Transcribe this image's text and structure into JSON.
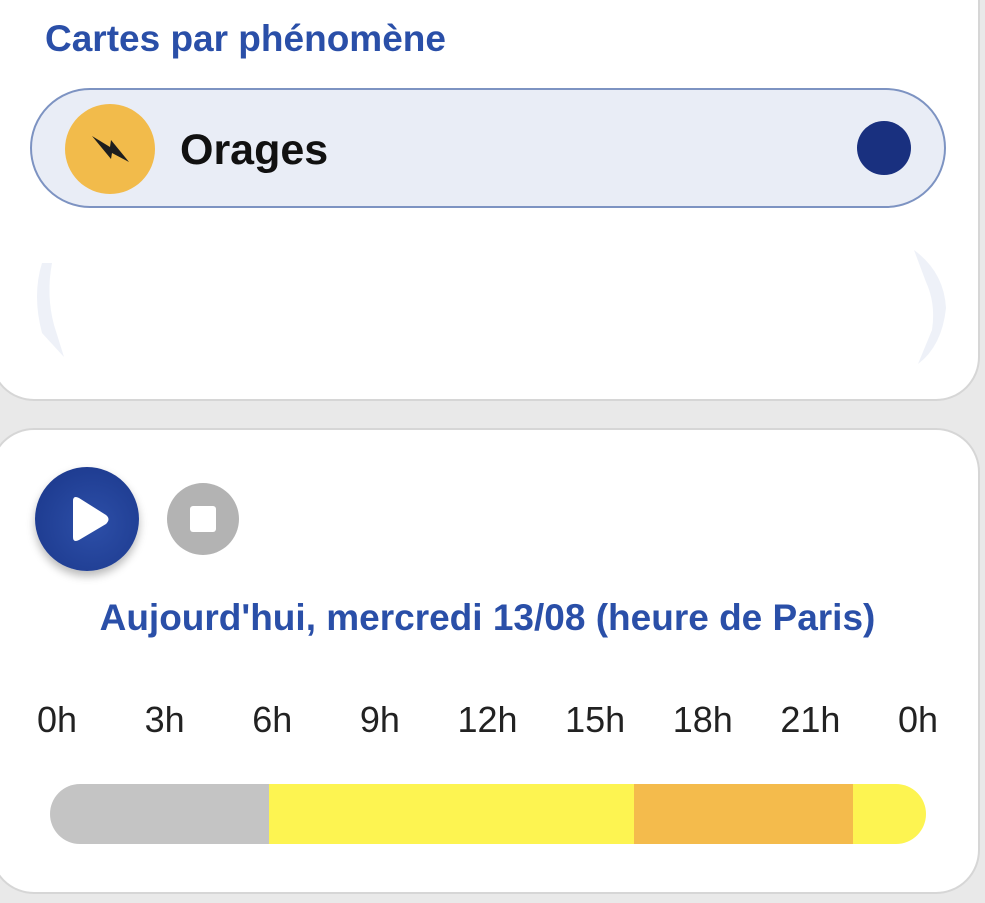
{
  "phenomenon_section": {
    "title": "Cartes par phénomène",
    "selected": {
      "label": "Orages",
      "icon": "lightning-icon",
      "icon_bg": "#f2bb4b",
      "status_color": "#19307f"
    }
  },
  "player": {
    "play_icon": "play-icon",
    "stop_icon": "stop-icon",
    "date_label": "Aujourd'hui, mercredi 13/08 (heure de Paris)"
  },
  "timeline": {
    "hours": [
      "0h",
      "3h",
      "6h",
      "9h",
      "12h",
      "15h",
      "18h",
      "21h",
      "0h"
    ],
    "segments": [
      {
        "from_hour": 0,
        "to_hour": 6,
        "color": "#c4c4c4"
      },
      {
        "from_hour": 6,
        "to_hour": 16,
        "color": "#fdf451"
      },
      {
        "from_hour": 16,
        "to_hour": 22,
        "color": "#f4bb4c"
      },
      {
        "from_hour": 22,
        "to_hour": 24,
        "color": "#fdf451"
      }
    ]
  }
}
